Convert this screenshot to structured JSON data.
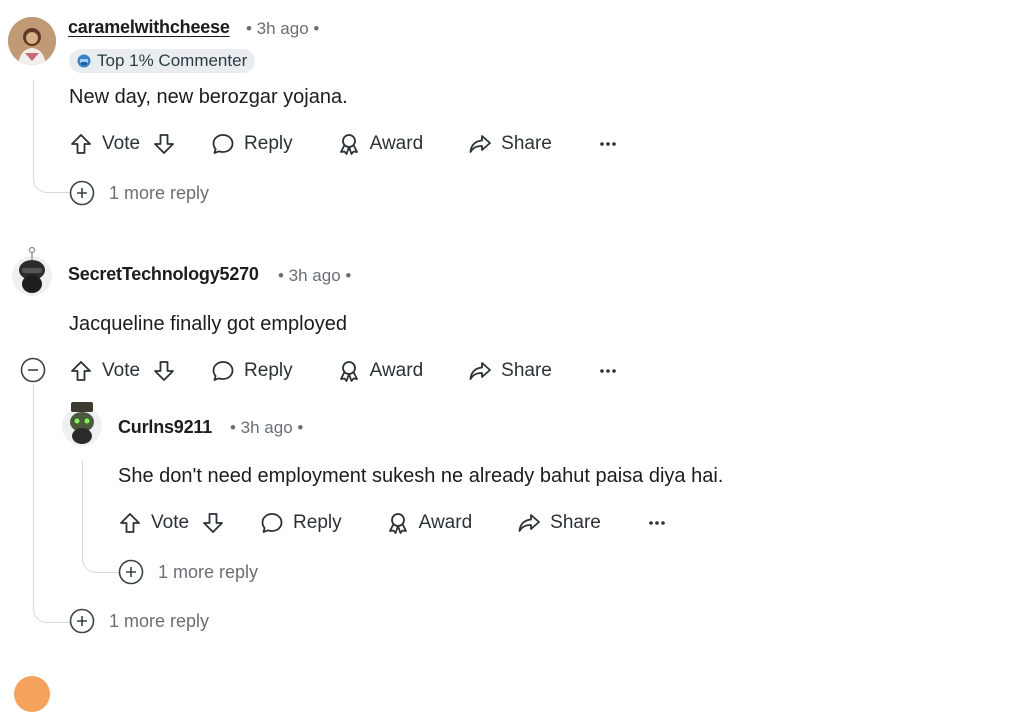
{
  "comments": [
    {
      "username": "caramelwithcheese",
      "meta": "• 3h ago •",
      "flair": "Top 1% Commenter",
      "text": "New day, new berozgar yojana.",
      "more_replies": "1 more reply"
    },
    {
      "username": "SecretTechnology5270",
      "meta": "• 3h ago •",
      "text": "Jacqueline finally got employed",
      "more_replies": "1 more reply",
      "reply": {
        "username": "Curlns9211",
        "meta": "• 3h ago •",
        "text": "She don't need employment sukesh ne already bahut paisa diya hai.",
        "more_replies": "1 more reply"
      }
    }
  ],
  "actions": {
    "vote": "Vote",
    "reply": "Reply",
    "award": "Award",
    "share": "Share",
    "more": "more-horizontal-icon"
  },
  "colors": {
    "text": "#1c1c1c",
    "meta": "#6a6f73",
    "thread_line": "#d7dadc",
    "flair_bg": "#eaedef"
  }
}
